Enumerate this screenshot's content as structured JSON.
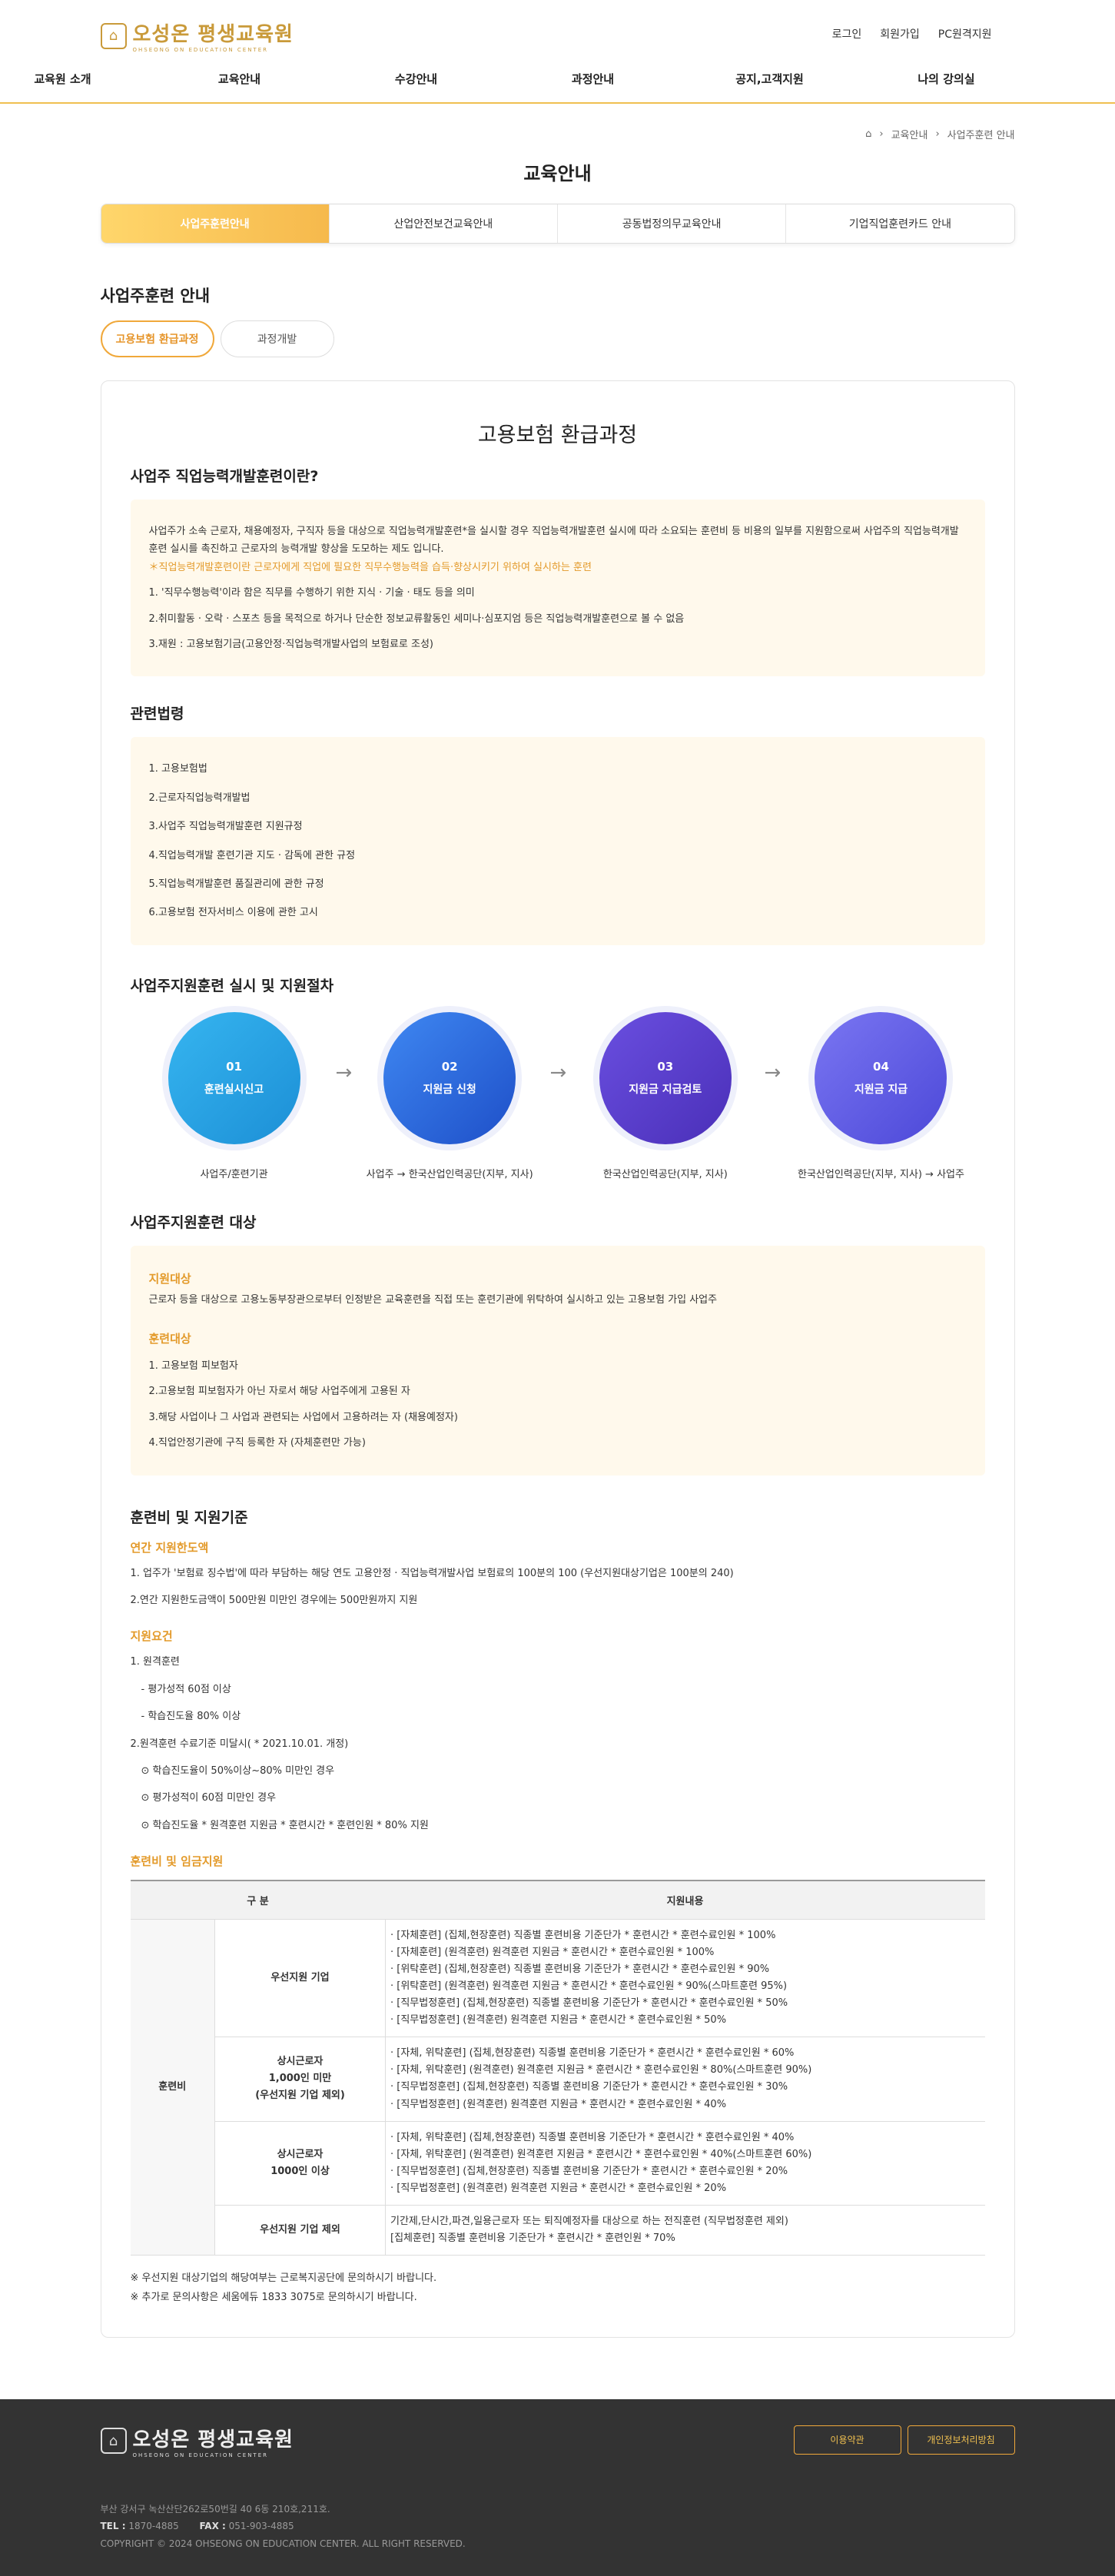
{
  "header": {
    "logo_main": "오성온 평생교육원",
    "logo_sub": "OHSEONG ON EDUCATION CENTER",
    "util": [
      "로그인",
      "회원가입",
      "PC원격지원"
    ],
    "gnb": [
      "교육원 소개",
      "교육안내",
      "수강안내",
      "과정안내",
      "공지,고객지원",
      "나의 강의실"
    ]
  },
  "breadcrumb": {
    "home_icon": "home-icon",
    "items": [
      "교육안내",
      "사업주훈련 안내"
    ]
  },
  "page_title": "교육안내",
  "tabs": [
    "사업주훈련안내",
    "산업안전보건교육안내",
    "공동법정의무교육안내",
    "기업직업훈련카드 안내"
  ],
  "section_title": "사업주훈련 안내",
  "subtabs": [
    "고용보험 환급과정",
    "과정개발"
  ],
  "card_title": "고용보험 환급과정",
  "what": {
    "title": "사업주 직업능력개발훈련이란?",
    "p1": "사업주가 소속 근로자, 채용예정자, 구직자 등을 대상으로 직업능력개발훈련*을 실시할 경우 직업능력개발훈련 실시에 따라 소요되는 훈련비 등 비용의 일부를 지원함으로써 사업주의 직업능력개발훈련 실시를 촉진하고 근로자의 능력개발 향상을 도모하는 제도 입니다.",
    "p1_note": "＊직업능력개발훈련이란 근로자에게 직업에 필요한 직무수행능력을 습득·향상시키기 위하여 실시하는 훈련",
    "p2": "1. '직무수행능력'이라 함은 직무를 수행하기 위한 지식 · 기술 · 태도 등을 의미",
    "p3": "2.취미활동 · 오락 · 스포츠 등을 목적으로 하거나 단순한 정보교류활동인 세미나·심포지엄 등은 직업능력개발훈련으로 볼 수 없음",
    "p4": "3.재원 : 고용보험기금(고용안정·직업능력개발사업의 보험료로 조성)"
  },
  "laws": {
    "title": "관련법령",
    "items": [
      "1. 고용보험법",
      "2.근로자직업능력개발법",
      "3.사업주 직업능력개발훈련 지원규정",
      "4.직업능력개발 훈련기관 지도 · 감독에 관한 규정",
      "5.직업능력개발훈련 품질관리에 관한 규정",
      "6.고용보험 전자서비스 이용에 관한 고시"
    ]
  },
  "process": {
    "title": "사업주지원훈련 실시 및 지원절차",
    "steps": [
      {
        "num": "01",
        "label": "훈련실시신고",
        "desc": "사업주/훈련기관"
      },
      {
        "num": "02",
        "label": "지원금 신청",
        "desc": "사업주 → 한국산업인력공단(지부, 지사)"
      },
      {
        "num": "03",
        "label": "지원금 지급검토",
        "desc": "한국산업인력공단(지부, 지사)"
      },
      {
        "num": "04",
        "label": "지원금 지급",
        "desc": "한국산업인력공단(지부, 지사) → 사업주"
      }
    ],
    "arrow_icon": "arrow-right-icon"
  },
  "target": {
    "title": "사업주지원훈련 대상",
    "support_h": "지원대상",
    "support_text": "근로자 등을 대상으로 고용노동부장관으로부터 인정받은 교육훈련을 직접 또는 훈련기관에 위탁하여 실시하고 있는 고용보험 가입 사업주",
    "training_h": "훈련대상",
    "training_items": [
      "1. 고용보험 피보험자",
      "2.고용보험 피보험자가 아닌 자로서 해당 사업주에게 고용된 자",
      "3.해당 사업이나 그 사업과 관련되는 사업에서 고용하려는 자 (채용예정자)",
      "4.직업안정기관에 구직 등록한 자 (자체훈련만 가능)"
    ]
  },
  "fees": {
    "title": "훈련비 및 지원기준",
    "annual_h": "연간 지원한도액",
    "annual": [
      "1. 업주가 '보험료 징수법'에 따라 부담하는 해당 연도 고용안정 · 직업능력개발사업 보험료의 100분의 100 (우선지원대상기업은 100분의 240)",
      "2.연간 지원한도금액이 500만원 미만인 경우에는 500만원까지 지원"
    ],
    "req_h": "지원요건",
    "req": [
      "1. 원격훈련",
      "- 평가성적 60점 이상",
      "- 학습진도율 80% 이상",
      "2.원격훈련 수료기준 미달시( * 2021.10.01. 개정)",
      "⊙ 학습진도율이 50%이상~80% 미만인 경우",
      "⊙ 평가성적이 60점 미만인 경우",
      "⊙ 학습진도율 * 원격훈련 지원금 * 훈련시간 * 훈련인원 * 80% 지원"
    ],
    "table_h": "훈련비 및 임금지원",
    "th": [
      "구 분",
      "지원내용"
    ],
    "group": "훈련비",
    "rows": [
      {
        "cat": "우선지원 기업",
        "lines": [
          "· [자체훈련] (집체,현장훈련) 직종별 훈련비용 기준단가 * 훈련시간 * 훈련수료인원 * 100%",
          "· [자체훈련] (원격훈련) 원격훈련 지원금 * 훈련시간 * 훈련수료인원 * 100%",
          "· [위탁훈련] (집체,현장훈련) 직종별 훈련비용 기준단가 * 훈련시간 * 훈련수료인원 * 90%",
          "· [위탁훈련] (원격훈련) 원격훈련 지원금 * 훈련시간 * 훈련수료인원 * 90%(스마트훈련 95%)",
          "· [직무법정훈련] (집체,현장훈련) 직종별 훈련비용 기준단가 * 훈련시간 * 훈련수료인원 * 50%",
          "· [직무법정훈련] (원격훈련) 원격훈련 지원금 * 훈련시간 * 훈련수료인원 * 50%"
        ]
      },
      {
        "cat": "상시근로자\n1,000인 미만\n(우선지원 기업 제외)",
        "lines": [
          "· [자체, 위탁훈련] (집체,현장훈련) 직종별 훈련비용 기준단가 * 훈련시간 * 훈련수료인원 * 60%",
          "· [자체, 위탁훈련] (원격훈련) 원격훈련 지원금 * 훈련시간 * 훈련수료인원 * 80%(스마트훈련 90%)",
          "· [직무법정훈련] (집체,현장훈련) 직종별 훈련비용 기준단가 * 훈련시간 * 훈련수료인원 * 30%",
          "· [직무법정훈련] (원격훈련) 원격훈련 지원금 * 훈련시간 * 훈련수료인원 * 40%"
        ]
      },
      {
        "cat": "상시근로자\n1000인 이상",
        "lines": [
          "· [자체, 위탁훈련] (집체,현장훈련) 직종별 훈련비용 기준단가 * 훈련시간 * 훈련수료인원 * 40%",
          "· [자체, 위탁훈련] (원격훈련) 원격훈련 지원금 * 훈련시간 * 훈련수료인원 * 40%(스마트훈련 60%)",
          "· [직무법정훈련] (집체,현장훈련) 직종별 훈련비용 기준단가 * 훈련시간 * 훈련수료인원 * 20%",
          "· [직무법정훈련] (원격훈련) 원격훈련 지원금 * 훈련시간 * 훈련수료인원 * 20%"
        ]
      },
      {
        "cat": "우선지원 기업 제외",
        "lines": [
          "기간제,단시간,파견,일용근로자 또는 퇴직예정자를 대상으로 하는 전직훈련 (직무법정훈련 제외)",
          "[집체훈련] 직종별 훈련비용 기준단가 * 훈련시간 * 훈련인원 * 70%"
        ]
      }
    ],
    "notes": [
      "※ 우선지원 대상기업의 해당여부는 근로복지공단에 문의하시기 바랍니다.",
      "※ 추가로 문의사항은 세움에듀 1833 3075로 문의하시기 바랍니다."
    ]
  },
  "footer": {
    "logo_main": "오성온 평생교육원",
    "logo_sub": "OHSEONG ON EDUCATION CENTER",
    "buttons": [
      "이용약관",
      "개인정보처리방침"
    ],
    "address": "부산 강서구 녹산산단262로50번길 40 6동 210호,211호.",
    "tel_label": "TEL :",
    "tel": "1870-4885",
    "fax_label": "FAX :",
    "fax": "051-903-4885",
    "copyright": "COPYRIGHT © 2024 OHSEONG ON EDUCATION CENTER. ALL RIGHT RESERVED."
  }
}
